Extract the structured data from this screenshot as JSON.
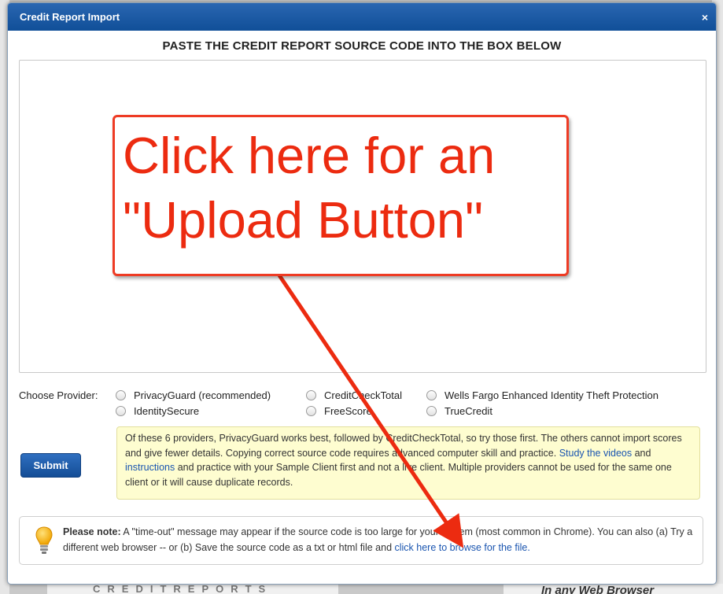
{
  "dialog": {
    "title": "Credit Report Import",
    "close_glyph": "×",
    "heading": "PASTE THE CREDIT REPORT SOURCE CODE INTO THE BOX BELOW",
    "source_value": ""
  },
  "providers": {
    "label": "Choose Provider:",
    "options": [
      "PrivacyGuard (recommended)",
      "CreditCheckTotal",
      "Wells Fargo Enhanced Identity Theft Protection",
      "IdentitySecure",
      "FreeScore",
      "TrueCredit"
    ]
  },
  "info": {
    "text_1": "Of these 6 providers, PrivacyGuard works best, followed by CreditCheckTotal, so try those first. The others cannot import scores and give fewer details. Copying correct source code requires advanced computer skill and practice. ",
    "link_videos": "Study the videos",
    "text_2": " and ",
    "link_instructions": "instructions",
    "text_3": " and practice with your Sample Client first and not a live client. Multiple providers cannot be used for the same one client or it will cause duplicate records."
  },
  "submit_label": "Submit",
  "note": {
    "bold": "Please note:",
    "text": " A \"time-out\" message may appear if the source code is too large for your system (most common in Chrome). You can also (a) Try a different web browser -- or (b) Save the source code as a txt or html file and ",
    "link": "click here to browse for the file."
  },
  "annotation": {
    "text": "Click here for an\n\"Upload Button\"",
    "color": "#ec2b10"
  },
  "background": {
    "bottom_left": "CREDITREPORTS",
    "bottom_right": "In any Web Browser"
  },
  "icons": {
    "close": "close-icon",
    "note": "lightbulb-icon"
  }
}
